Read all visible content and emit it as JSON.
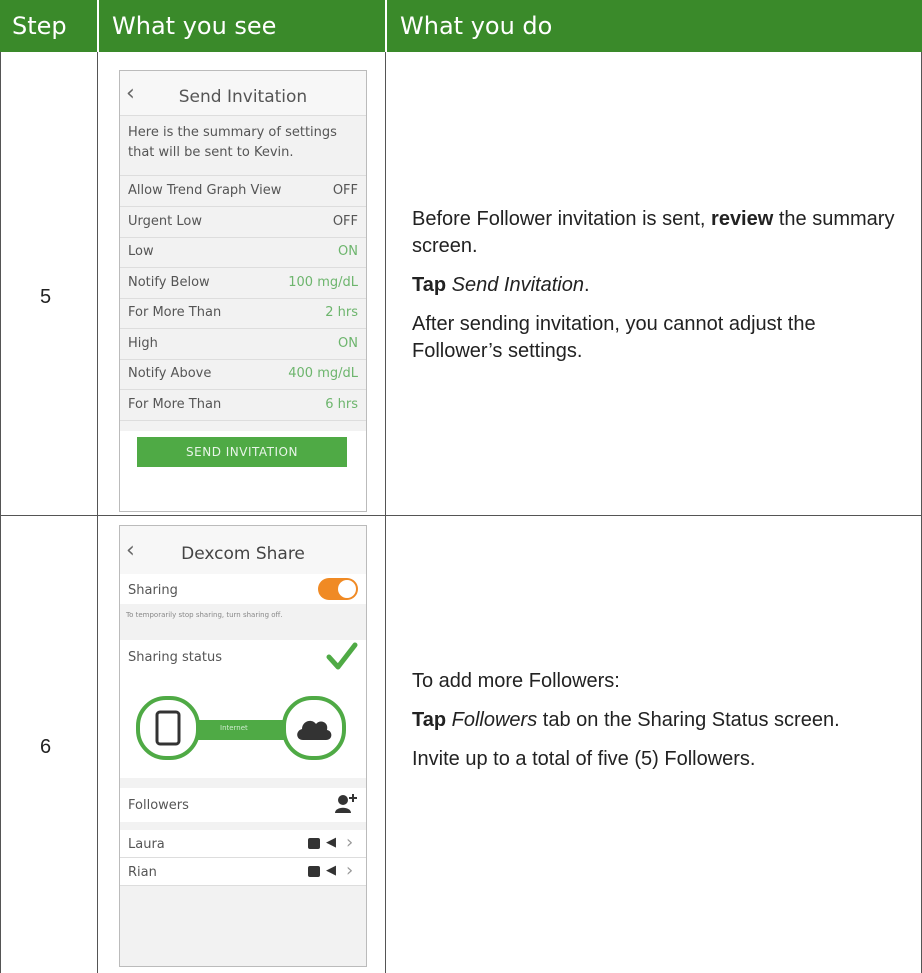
{
  "header": {
    "step": "Step",
    "see": "What you see",
    "do": "What you do"
  },
  "rows": [
    {
      "step": "5",
      "phone": {
        "title": "Send Invitation",
        "summary_line1": "Here is the summary of settings",
        "summary_line2": "that will be sent to Kevin.",
        "settings": [
          {
            "label": "Allow Trend Graph View",
            "value": "OFF",
            "green": false
          },
          {
            "label": "Urgent Low",
            "value": "OFF",
            "green": false
          },
          {
            "label": "Low",
            "value": "ON",
            "green": true
          },
          {
            "label": "Notify Below",
            "value": "100 mg/dL",
            "green": true
          },
          {
            "label": "For More Than",
            "value": "2 hrs",
            "green": true
          },
          {
            "label": "High",
            "value": "ON",
            "green": true
          },
          {
            "label": "Notify Above",
            "value": "400 mg/dL",
            "green": true
          },
          {
            "label": "For More Than",
            "value": "6 hrs",
            "green": true
          }
        ],
        "button": "SEND INVITATION"
      },
      "desc": {
        "p1_pre": "Before Follower invitation is sent, ",
        "p1_bold": "review",
        "p1_post": " the summary screen.",
        "p2_bold": "Tap",
        "p2_italic": "Send Invitation",
        "p2_post": ".",
        "p3": "After sending invitation, you cannot adjust the Follower’s settings."
      }
    },
    {
      "step": "6",
      "phone": {
        "title": "Dexcom Share",
        "sharing_label": "Sharing",
        "sharing_hint": "To temporarily stop sharing, turn sharing off.",
        "status_label": "Sharing status",
        "connector_label": "Internet",
        "followers_label": "Followers",
        "followers": [
          "Laura",
          "Rian"
        ]
      },
      "desc": {
        "p1": "To add more Followers:",
        "p2_bold": "Tap",
        "p2_italic": "Followers",
        "p2_post": " tab on the Sharing Status screen.",
        "p3": "Invite up to a total of five (5) Followers."
      }
    }
  ],
  "colors": {
    "header_bg": "#3a8a2a",
    "accent_green": "#6db56d",
    "toggle_orange": "#f08a24"
  }
}
